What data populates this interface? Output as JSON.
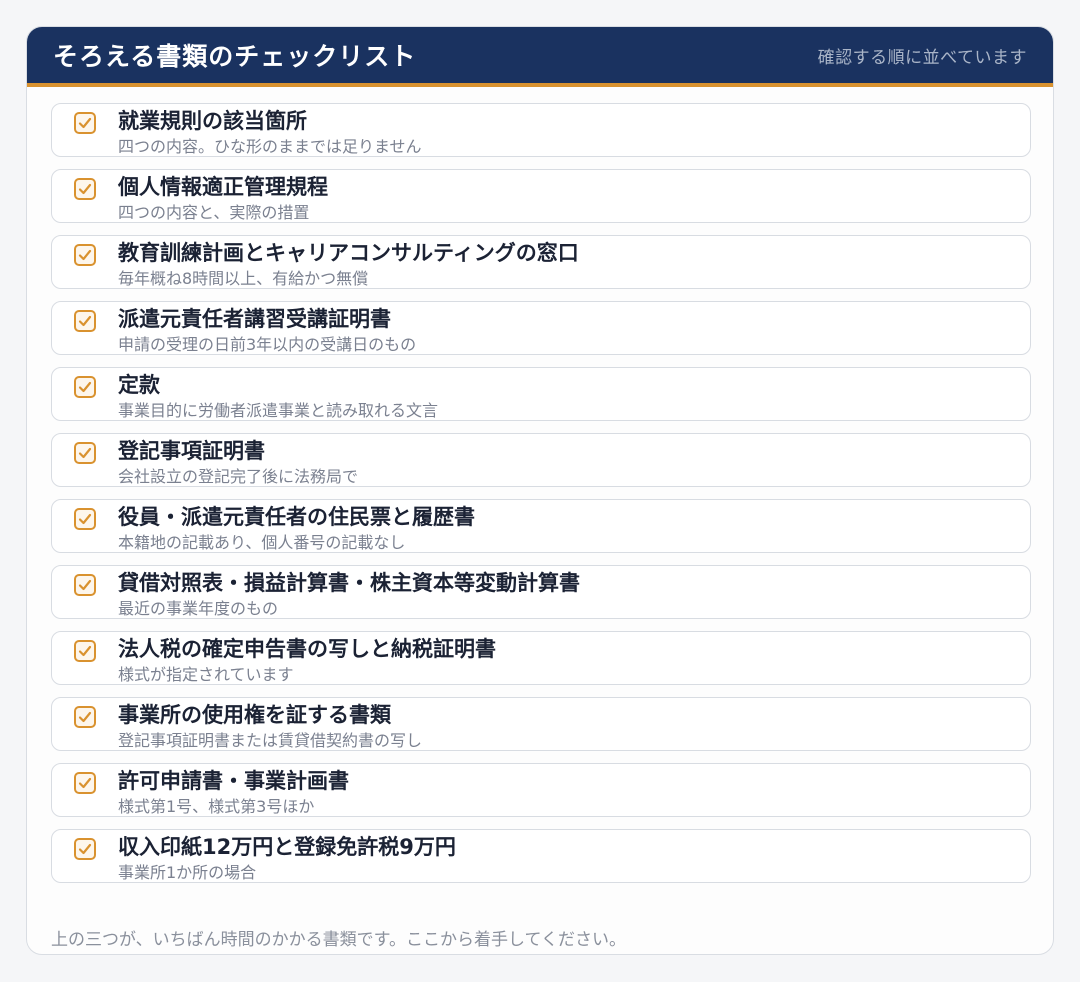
{
  "header": {
    "title": "そろえる書類のチェックリスト",
    "subtitle": "確認する順に並べています"
  },
  "items": [
    {
      "title": "就業規則の該当箇所",
      "note": "四つの内容。ひな形のままでは足りません",
      "checked": true
    },
    {
      "title": "個人情報適正管理規程",
      "note": "四つの内容と、実際の措置",
      "checked": true
    },
    {
      "title": "教育訓練計画とキャリアコンサルティングの窓口",
      "note": "毎年概ね8時間以上、有給かつ無償",
      "checked": true
    },
    {
      "title": "派遣元責任者講習受講証明書",
      "note": "申請の受理の日前3年以内の受講日のもの",
      "checked": true
    },
    {
      "title": "定款",
      "note": "事業目的に労働者派遣事業と読み取れる文言",
      "checked": true
    },
    {
      "title": "登記事項証明書",
      "note": "会社設立の登記完了後に法務局で",
      "checked": true
    },
    {
      "title": "役員・派遣元責任者の住民票と履歴書",
      "note": "本籍地の記載あり、個人番号の記載なし",
      "checked": true
    },
    {
      "title": "貸借対照表・損益計算書・株主資本等変動計算書",
      "note": "最近の事業年度のもの",
      "checked": true
    },
    {
      "title": "法人税の確定申告書の写しと納税証明書",
      "note": "様式が指定されています",
      "checked": true
    },
    {
      "title": "事業所の使用権を証する書類",
      "note": "登記事項証明書または賃貸借契約書の写し",
      "checked": true
    },
    {
      "title": "許可申請書・事業計画書",
      "note": "様式第1号、様式第3号ほか",
      "checked": true
    },
    {
      "title": "収入印紙12万円と登録免許税9万円",
      "note": "事業所1か所の場合",
      "checked": true
    }
  ],
  "footer": {
    "text": "上の三つが、いちばん時間のかかる書類です。ここから着手してください。"
  },
  "colors": {
    "header_bg": "#1a3260",
    "accent": "#d9922f"
  }
}
